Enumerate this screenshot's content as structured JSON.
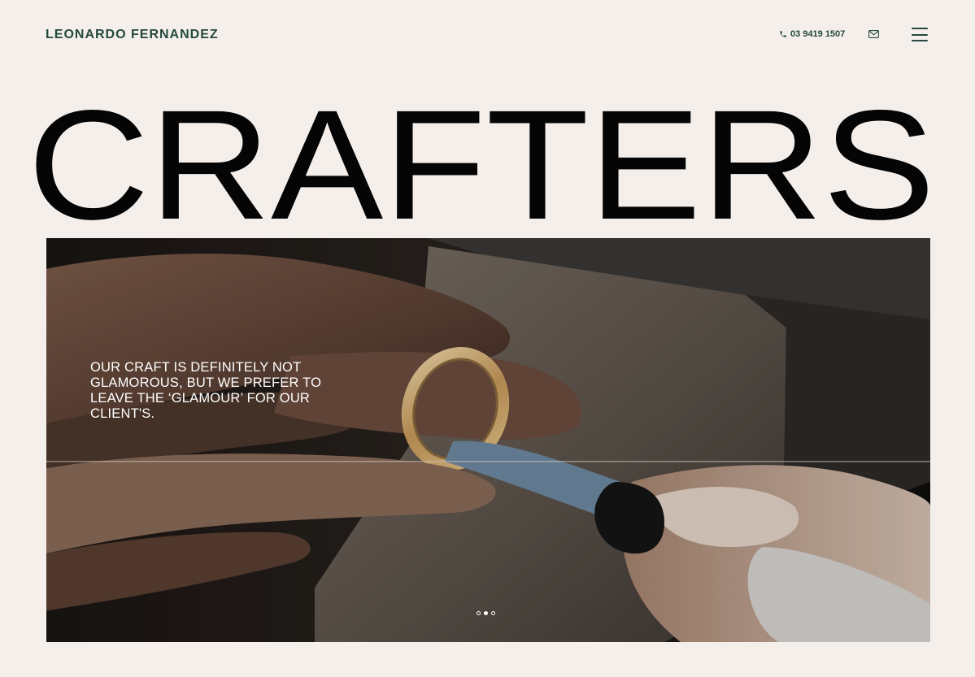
{
  "header": {
    "brand": "LEONARDO FERNANDEZ",
    "phone": "03 9419 1507",
    "phone_icon": "phone-icon",
    "mail_icon": "mail-icon",
    "menu_icon": "hamburger-menu-icon"
  },
  "hero": {
    "title": "CRAFTERS"
  },
  "slideshow": {
    "caption": "OUR CRAFT IS DEFINITELY NOT GLAMOROUS, BUT WE PREFER TO LEAVE THE ‘GLAMOUR’ FOR OUR CLIENT'S.",
    "slide_count": 3,
    "active_slide": 2
  },
  "colors": {
    "background": "#f4efeb",
    "brand_green": "#24483f",
    "title": "#050505"
  }
}
